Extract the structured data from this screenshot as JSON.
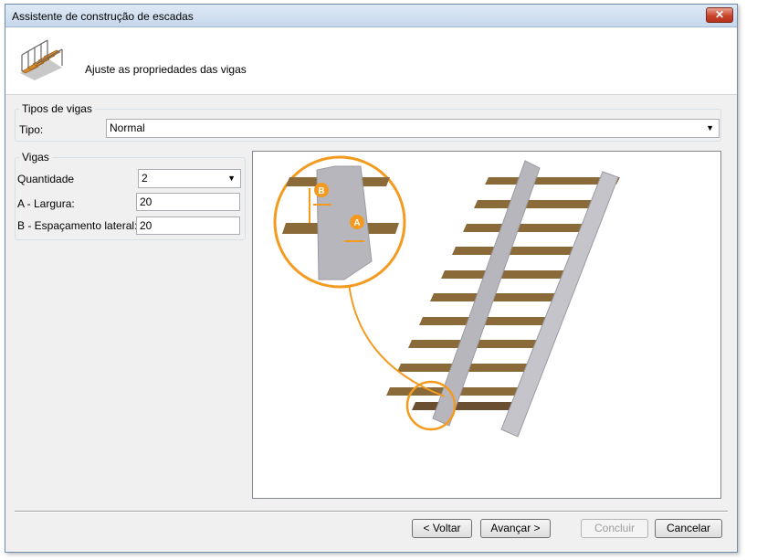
{
  "window": {
    "title": "Assistente de construção de escadas",
    "close_label": "✕"
  },
  "header": {
    "subtitle": "Ajuste as propriedades das vigas"
  },
  "tipos_group": {
    "legend": "Tipos de vigas",
    "tipo_label": "Tipo:",
    "tipo_value": "Normal"
  },
  "vigas_group": {
    "legend": "Vigas",
    "quantidade_label": "Quantidade",
    "quantidade_value": "2",
    "largura_label": "A - Largura:",
    "largura_value": "20",
    "espacamento_label": "B - Espaçamento lateral:",
    "espacamento_value": "20"
  },
  "preview": {
    "marker_a": "A",
    "marker_b": "B"
  },
  "buttons": {
    "back": "< Voltar",
    "next": "Avançar >",
    "finish": "Concluir",
    "cancel": "Cancelar"
  },
  "colors": {
    "accent_orange": "#f39a1f",
    "wood": "#8b6a3a",
    "stringer": "#b6b6bc"
  }
}
